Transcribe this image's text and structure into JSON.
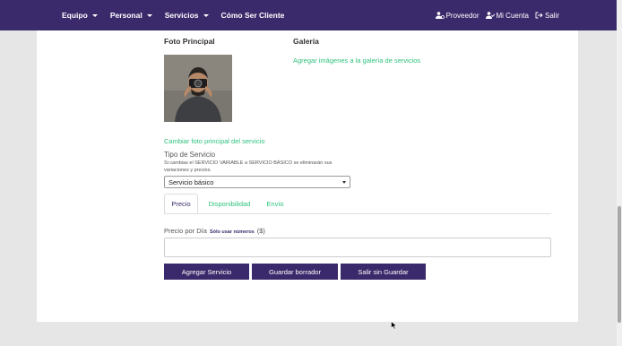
{
  "nav": {
    "left": [
      {
        "label": "Equipo",
        "has_caret": true
      },
      {
        "label": "Personal",
        "has_caret": true
      },
      {
        "label": "Servicios",
        "has_caret": true
      },
      {
        "label": "Cómo Ser Cliente",
        "has_caret": false
      }
    ],
    "right": [
      {
        "label": "Proveedor",
        "icon": "user-cog-icon"
      },
      {
        "label": "Mi Cuenta",
        "icon": "user-check-icon"
      },
      {
        "label": "Salir",
        "icon": "sign-out-icon"
      }
    ]
  },
  "main": {
    "foto_title": "Foto Principal",
    "galeria_title": "Galería",
    "galeria_link": "Agregar imágenes a la galería de servicios",
    "change_photo_link": "Cambiar foto principal del servicio",
    "tipo_label": "Tipo de Servicio",
    "tipo_note": "Si cambias el SERVICIO VARIABLE a SERVICIO BÁSICO se eliminarán sus variaciones y precios.",
    "tipo_value": "Servicio básico",
    "tabs": [
      "Precio",
      "Disponibilidad",
      "Envío"
    ],
    "active_tab": "Precio",
    "price_label": "Precio por Día",
    "price_hint": "Sólo usar números",
    "price_unit": "($)",
    "price_value": "",
    "buttons": {
      "add": "Agregar Servicio",
      "draft": "Guardar borrador",
      "exit": "Salir sin Guardar"
    }
  },
  "colors": {
    "nav_bg": "#3b2a6b",
    "link": "#2ec27e",
    "button_bg": "#3b2a6b"
  }
}
